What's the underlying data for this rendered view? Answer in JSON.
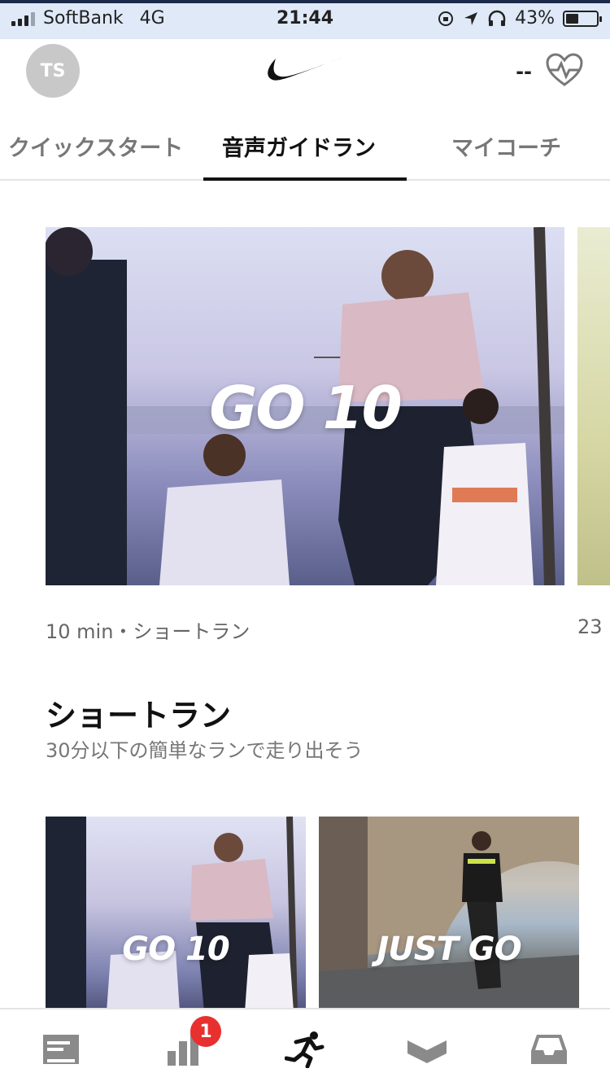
{
  "status_bar": {
    "carrier": "SoftBank",
    "network": "4G",
    "time": "21:44",
    "battery": "43%",
    "battery_level": 0.43
  },
  "header": {
    "avatar_initials": "TS",
    "heart_rate": "--"
  },
  "tabs": [
    {
      "label": "クイックスタート",
      "active": false
    },
    {
      "label": "音声ガイドラン",
      "active": true
    },
    {
      "label": "マイコーチ",
      "active": false
    }
  ],
  "featured": {
    "title": "GO 10",
    "meta": "10 min・ショートラン",
    "next_meta": "23"
  },
  "section": {
    "title": "ショートラン",
    "subtitle": "30分以下の簡単なランで走り出そう"
  },
  "thumbnails": [
    {
      "title": "GO 10"
    },
    {
      "title": "JUST GO"
    }
  ],
  "tab_bar": {
    "items": [
      {
        "icon": "feed-icon"
      },
      {
        "icon": "activity-icon",
        "badge": "1"
      },
      {
        "icon": "run-icon",
        "active": true
      },
      {
        "icon": "plans-icon"
      },
      {
        "icon": "inbox-icon"
      }
    ]
  },
  "colors": {
    "accent": "#111111",
    "badge": "#e8302f",
    "status_bar_bg": "#dfe9f8"
  }
}
